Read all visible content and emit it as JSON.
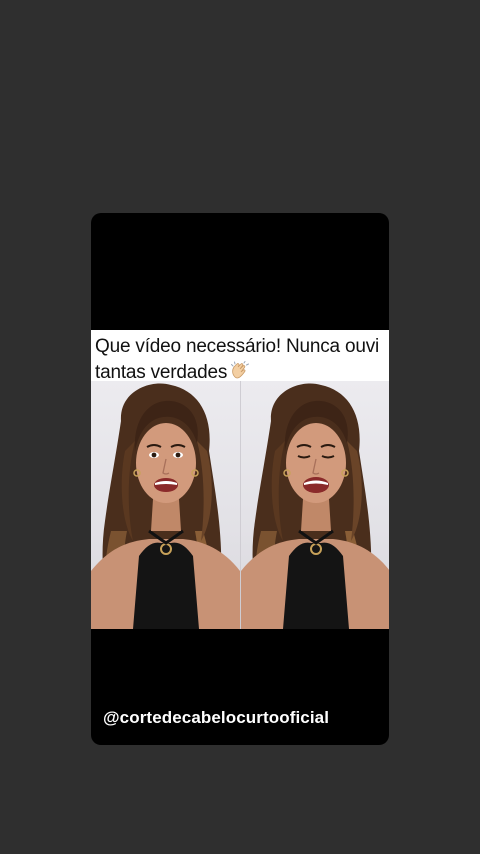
{
  "post": {
    "caption": "Que vídeo necessário! Nunca ouvi tantas verdades",
    "caption_icon": "clapping-hands-emoji",
    "mention": "@cortedecabelocurtooficial"
  },
  "video": {
    "frames": [
      {
        "description_icon": "woman-speaking-frame"
      },
      {
        "description_icon": "woman-speaking-frame"
      }
    ]
  },
  "colors": {
    "background": "#2f2f2f",
    "card": "#000000",
    "caption_bg": "#ffffff",
    "mention_text": "#ffffff"
  }
}
